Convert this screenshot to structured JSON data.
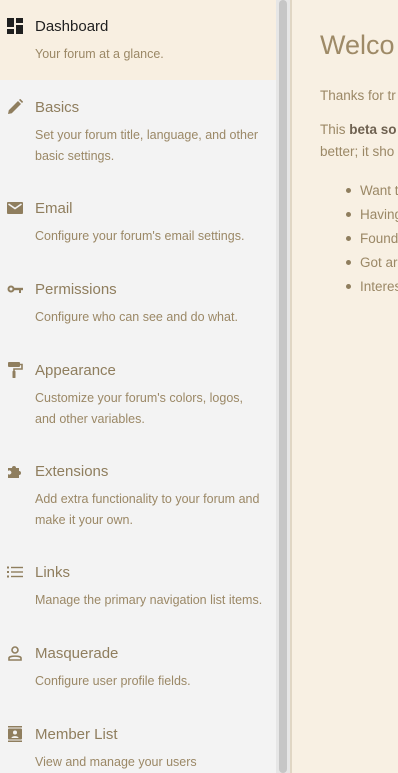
{
  "sidebar": {
    "items": [
      {
        "title": "Dashboard",
        "desc": "Your forum at a glance.",
        "icon": "dashboard-icon"
      },
      {
        "title": "Basics",
        "desc": "Set your forum title, language, and other basic settings.",
        "icon": "pencil-icon"
      },
      {
        "title": "Email",
        "desc": "Configure your forum's email settings.",
        "icon": "envelope-icon"
      },
      {
        "title": "Permissions",
        "desc": "Configure who can see and do what.",
        "icon": "key-icon"
      },
      {
        "title": "Appearance",
        "desc": "Customize your forum's colors, logos, and other variables.",
        "icon": "paint-roller-icon"
      },
      {
        "title": "Extensions",
        "desc": "Add extra functionality to your forum and make it your own.",
        "icon": "puzzle-piece-icon"
      },
      {
        "title": "Links",
        "desc": "Manage the primary navigation list items.",
        "icon": "list-icon"
      },
      {
        "title": "Masquerade",
        "desc": "Configure user profile fields.",
        "icon": "user-icon"
      },
      {
        "title": "Member List",
        "desc": "View and manage your users",
        "icon": "contact-card-icon"
      }
    ]
  },
  "main": {
    "title": "Welco",
    "p1": "Thanks for tr",
    "p2_prefix": "This ",
    "p2_bold": "beta so",
    "p3": "better; it sho",
    "bullets": [
      "Want t",
      "Having",
      "Found",
      "Got ar",
      "Interes"
    ]
  },
  "colors": {
    "sidebar_bg": "#f3f3f3",
    "active_bg": "#f8efe1",
    "content_bg": "#f8f0e3",
    "accent_text": "#8f7e5e"
  }
}
